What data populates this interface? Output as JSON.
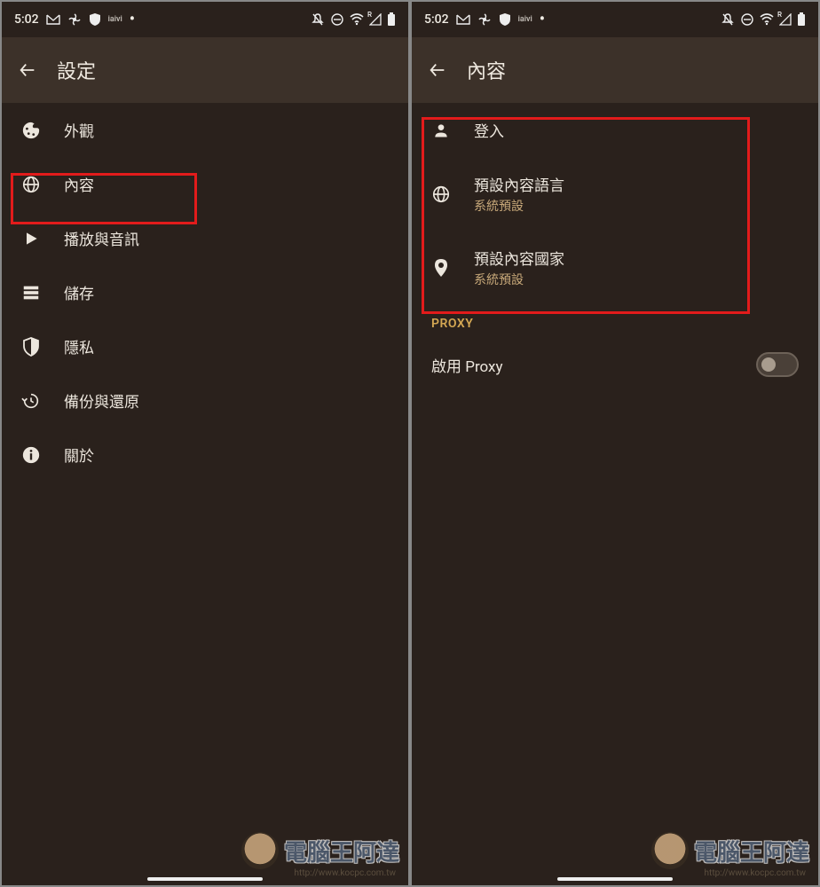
{
  "status": {
    "time": "5:02",
    "iqiyi_label": "iaivi"
  },
  "left": {
    "title": "設定",
    "items": [
      {
        "label": "外觀"
      },
      {
        "label": "內容"
      },
      {
        "label": "播放與音訊"
      },
      {
        "label": "儲存"
      },
      {
        "label": "隱私"
      },
      {
        "label": "備份與還原"
      },
      {
        "label": "關於"
      }
    ]
  },
  "right": {
    "title": "內容",
    "items": [
      {
        "label": "登入",
        "sub": ""
      },
      {
        "label": "預設內容語言",
        "sub": "系統預設"
      },
      {
        "label": "預設內容國家",
        "sub": "系統預設"
      }
    ],
    "section_proxy": "PROXY",
    "proxy_toggle_label": "啟用 Proxy"
  },
  "watermark": {
    "text": "電腦王阿達",
    "url": "http://www.kocpc.com.tw"
  }
}
